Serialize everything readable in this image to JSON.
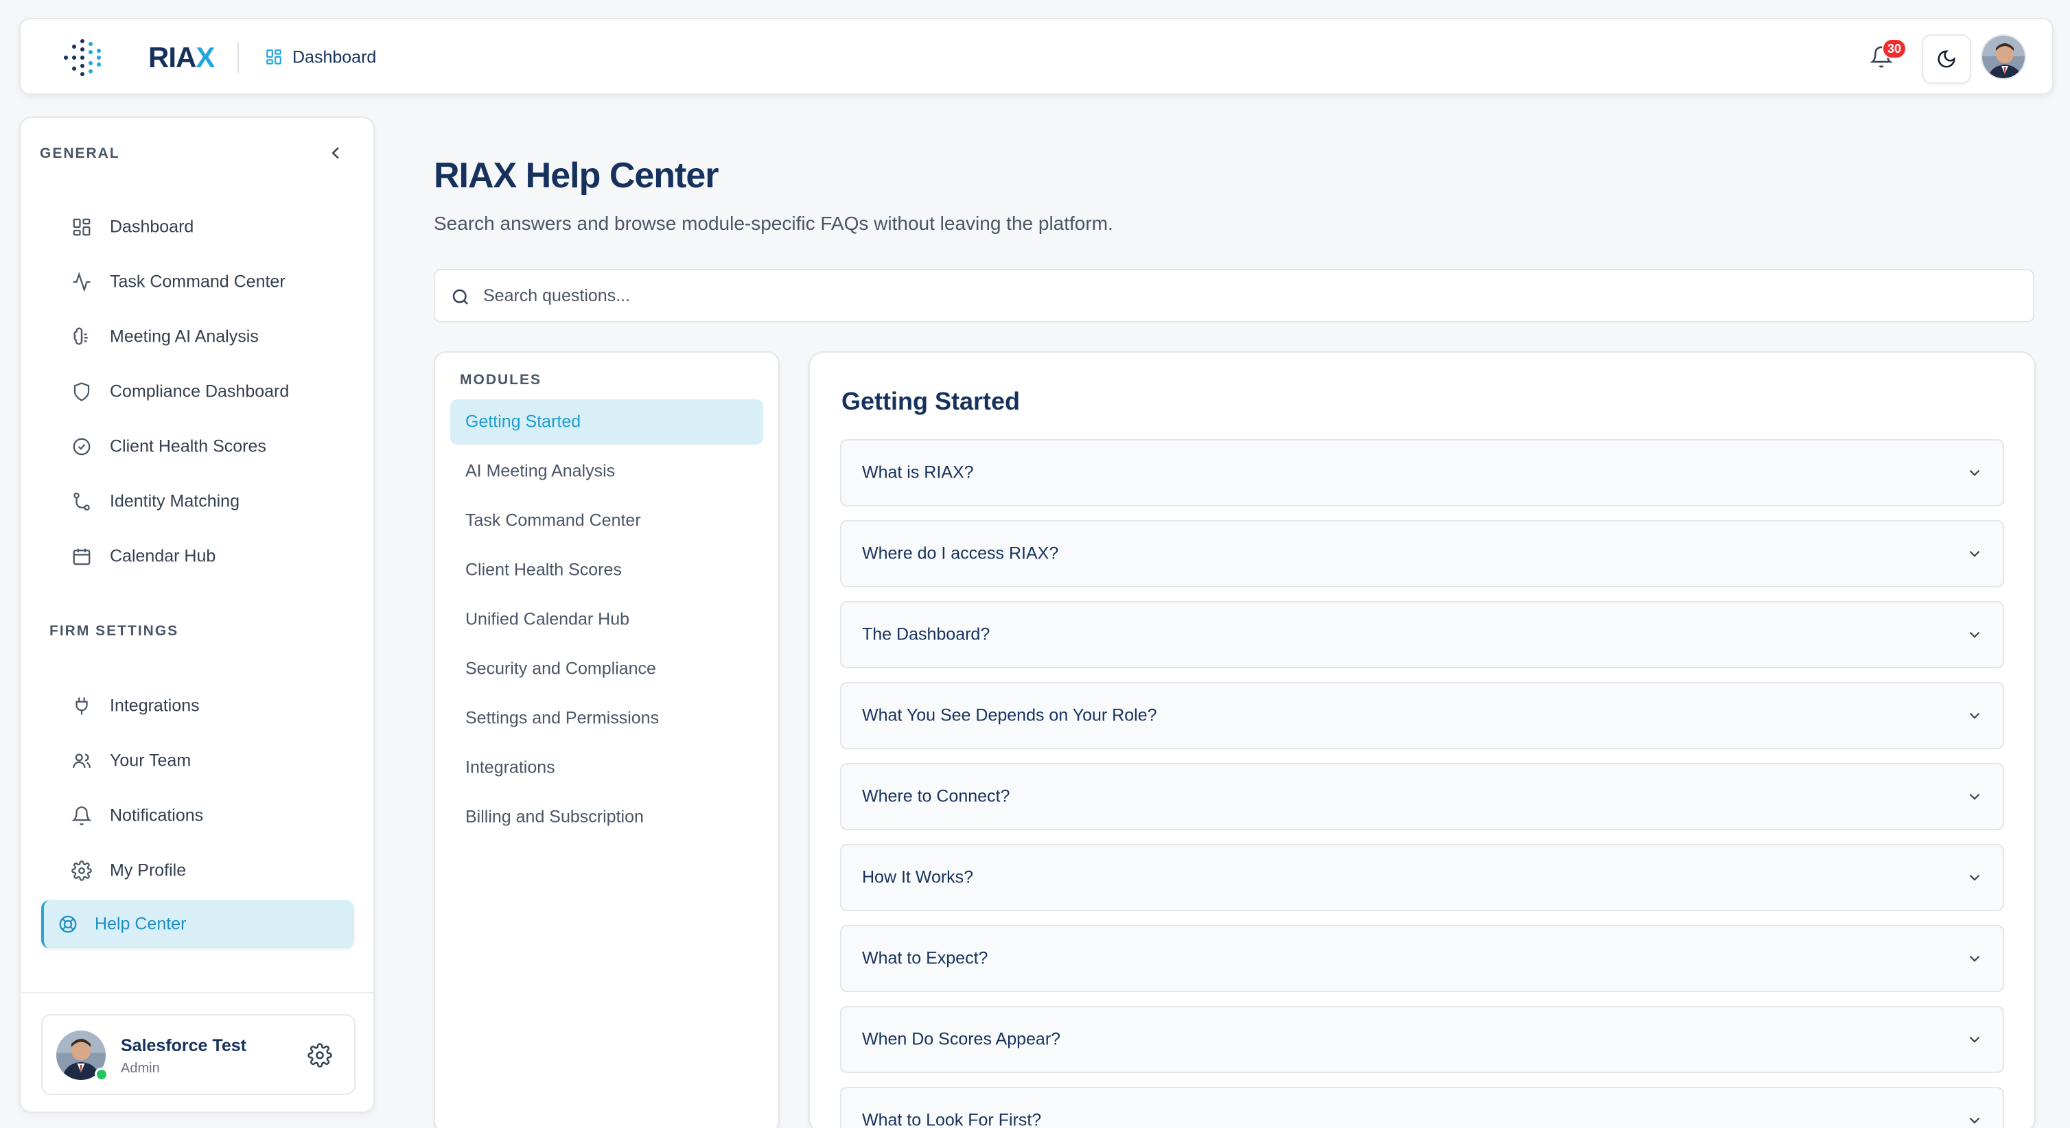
{
  "header": {
    "logo_text": "RIA",
    "logo_accent": "X",
    "breadcrumb": "Dashboard",
    "notification_count": "30",
    "logo_icon": "dot-grid-logo-icon",
    "theme_icon": "moon-icon",
    "bell_icon": "bell-icon"
  },
  "sidebar": {
    "general_heading": "GENERAL",
    "firm_heading": "FIRM SETTINGS",
    "general_items": [
      {
        "label": "Dashboard",
        "icon": "grid-icon"
      },
      {
        "label": "Task Command Center",
        "icon": "activity-icon"
      },
      {
        "label": "Meeting AI Analysis",
        "icon": "brain-icon"
      },
      {
        "label": "Compliance Dashboard",
        "icon": "shield-icon"
      },
      {
        "label": "Client Health Scores",
        "icon": "check-circle-icon"
      },
      {
        "label": "Identity Matching",
        "icon": "git-branch-icon"
      },
      {
        "label": "Calendar Hub",
        "icon": "calendar-icon"
      }
    ],
    "firm_items": [
      {
        "label": "Integrations",
        "icon": "plug-icon"
      },
      {
        "label": "Your Team",
        "icon": "users-icon"
      },
      {
        "label": "Notifications",
        "icon": "bell-icon"
      },
      {
        "label": "My Profile",
        "icon": "gear-icon"
      },
      {
        "label": "Help Center",
        "icon": "lifebuoy-icon",
        "active": true
      }
    ],
    "user": {
      "name": "Salesforce Test",
      "role": "Admin"
    }
  },
  "main": {
    "title": "RIAX Help Center",
    "subtitle": "Search answers and browse module-specific FAQs without leaving the platform.",
    "search_placeholder": "Search questions...",
    "modules_heading": "MODULES",
    "modules": [
      "Getting Started",
      "AI Meeting Analysis",
      "Task Command Center",
      "Client Health Scores",
      "Unified Calendar Hub",
      "Security and Compliance",
      "Settings and Permissions",
      "Integrations",
      "Billing and Subscription"
    ],
    "active_module": "Getting Started",
    "faq_title": "Getting Started",
    "faqs": [
      "What is RIAX?",
      "Where do I access RIAX?",
      "The Dashboard?",
      "What You See Depends on Your Role?",
      "Where to Connect?",
      "How It Works?",
      "What to Expect?",
      "When Do Scores Appear?",
      "What to Look For First?"
    ]
  },
  "colors": {
    "brand_navy": "#16325c",
    "accent_blue": "#22a6dd",
    "active_bg": "#d8eff8",
    "badge_red": "#ef2d2d",
    "online_green": "#22c55e"
  }
}
